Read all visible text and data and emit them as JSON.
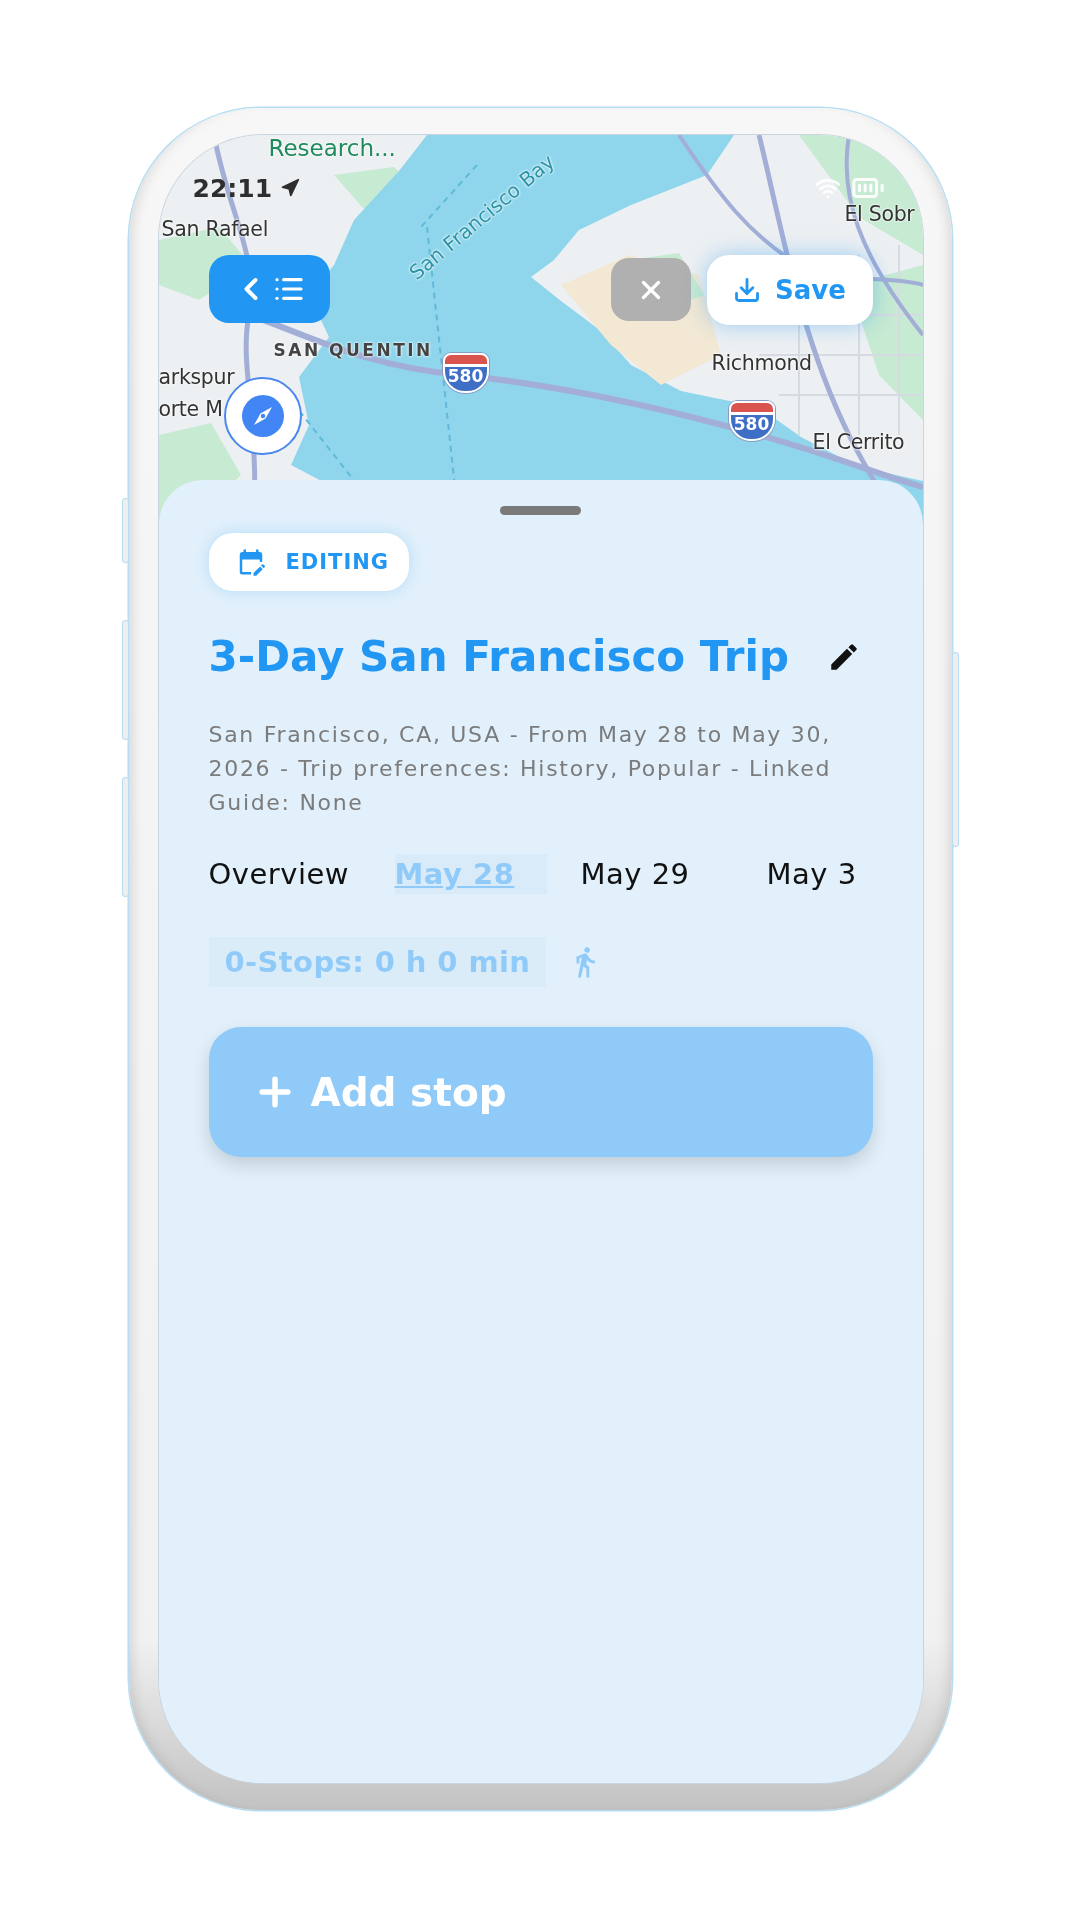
{
  "status_bar": {
    "time": "22:11"
  },
  "map": {
    "labels": [
      {
        "text": "Research...",
        "kind": "poi"
      },
      {
        "text": "El Sobr",
        "kind": "place"
      },
      {
        "text": "San Rafael",
        "kind": "place"
      },
      {
        "text": "San Francisco Bay",
        "kind": "water"
      },
      {
        "text": "SAN QUENTIN",
        "kind": "area"
      },
      {
        "text": "580",
        "kind": "shield"
      },
      {
        "text": "Richmond",
        "kind": "place"
      },
      {
        "text": "arkspur",
        "kind": "place"
      },
      {
        "text": "orte M",
        "kind": "place"
      },
      {
        "text": "580",
        "kind": "shield"
      },
      {
        "text": "El Cerrito",
        "kind": "place"
      }
    ]
  },
  "toolbar": {
    "save": "Save"
  },
  "sheet": {
    "badge": "EDITING",
    "title": "3-Day San Francisco Trip",
    "description": "San Francisco, CA, USA - From May 28 to May 30, 2026 - Trip preferences: History, Popular - Linked Guide: None",
    "tabs": [
      {
        "label": "Overview",
        "selected": false
      },
      {
        "label": "May 28",
        "selected": true
      },
      {
        "label": "May 29",
        "selected": false
      },
      {
        "label": "May 3",
        "selected": false
      }
    ],
    "summary": "0-Stops: 0 h 0 min",
    "add_button": "Add stop"
  }
}
